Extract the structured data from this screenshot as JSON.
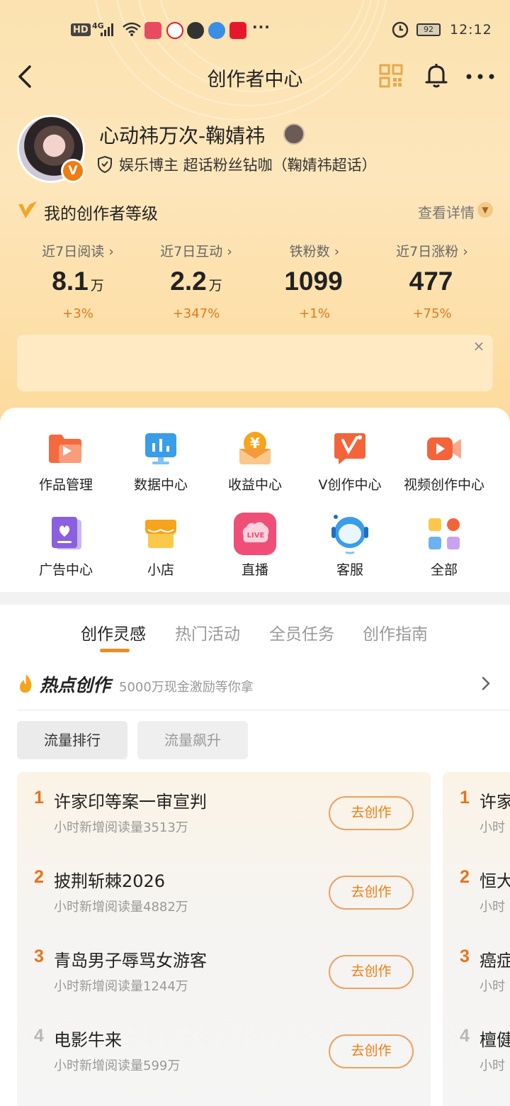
{
  "status_bar": {
    "hd": "HD",
    "net": "4G",
    "more": "···",
    "battery": "92",
    "time": "12:12"
  },
  "nav": {
    "title": "创作者中心"
  },
  "profile": {
    "name": "心动祎万次-鞠婧祎",
    "verify": "娱乐博主 超话粉丝钻咖（鞠婧祎超话）",
    "badge": "V"
  },
  "level": {
    "title": "我的创作者等级",
    "detail": "查看详情"
  },
  "stats": [
    {
      "label": "近7日阅读 ›",
      "value": "8.1",
      "unit": "万",
      "delta": "+3%"
    },
    {
      "label": "近7日互动 ›",
      "value": "2.2",
      "unit": "万",
      "delta": "+347%"
    },
    {
      "label": "铁粉数 ›",
      "value": "1099",
      "unit": "",
      "delta": "+1%"
    },
    {
      "label": "近7日涨粉 ›",
      "value": "477",
      "unit": "",
      "delta": "+75%"
    }
  ],
  "banner": {
    "close": "×"
  },
  "tools": [
    {
      "label": "作品管理",
      "icon": "folder-play-icon"
    },
    {
      "label": "数据中心",
      "icon": "chart-icon"
    },
    {
      "label": "收益中心",
      "icon": "yen-coin-icon"
    },
    {
      "label": "V创作中心",
      "icon": "v-create-icon"
    },
    {
      "label": "视频创作中心",
      "icon": "video-camera-icon"
    },
    {
      "label": "广告中心",
      "icon": "ad-book-icon"
    },
    {
      "label": "小店",
      "icon": "shop-icon"
    },
    {
      "label": "直播",
      "icon": "live-icon"
    },
    {
      "label": "客服",
      "icon": "headset-icon"
    },
    {
      "label": "全部",
      "icon": "grid-icon"
    }
  ],
  "tabs": [
    "创作灵感",
    "热门活动",
    "全员任务",
    "创作指南"
  ],
  "hot": {
    "title": "热点创作",
    "subtitle": "5000万现金激励等你拿"
  },
  "pills": [
    "流量排行",
    "流量飙升"
  ],
  "ranking": [
    {
      "num": "1",
      "title": "许家印等案一审宣判",
      "sub": "小时新增阅读量3513万",
      "button": "去创作"
    },
    {
      "num": "2",
      "title": "披荆斩棘2026",
      "sub": "小时新增阅读量4882万",
      "button": "去创作"
    },
    {
      "num": "3",
      "title": "青岛男子辱骂女游客",
      "sub": "小时新增阅读量1244万",
      "button": "去创作"
    },
    {
      "num": "4",
      "title": "电影牛来",
      "sub": "小时新增阅读量599万",
      "button": "去创作"
    }
  ],
  "ranking2": [
    {
      "num": "1",
      "title": "许家",
      "sub": "小时"
    },
    {
      "num": "2",
      "title": "恒大",
      "sub": "小时"
    },
    {
      "num": "3",
      "title": "癌症",
      "sub": "小时"
    },
    {
      "num": "4",
      "title": "檀健",
      "sub": "小时"
    }
  ],
  "colors": {
    "accent": "#f07c12",
    "rank_top": "#e8731a",
    "rank_other": "#b8b8b8",
    "bg_gradient_top": "#fbe2b0"
  }
}
